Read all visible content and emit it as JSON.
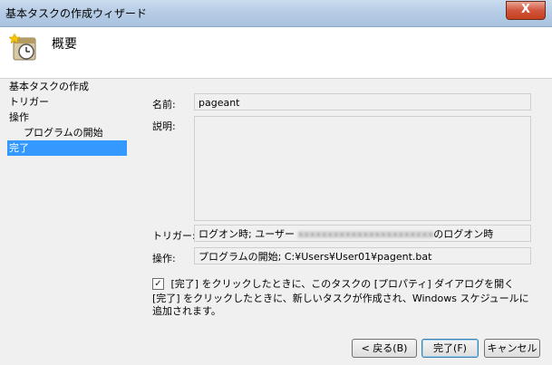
{
  "window": {
    "title": "基本タスクの作成ウィザード",
    "close_symbol": "X"
  },
  "header": {
    "title": "概要",
    "icon": "task-scheduler-clock-icon"
  },
  "nav": {
    "items": [
      {
        "label": "基本タスクの作成",
        "selected": false
      },
      {
        "label": "トリガー",
        "selected": false
      },
      {
        "label": "操作",
        "selected": false
      },
      {
        "label": "プログラムの開始",
        "selected": false,
        "sub": true
      },
      {
        "label": "完了",
        "selected": true
      }
    ]
  },
  "form": {
    "name_label": "名前:",
    "name_value": "pageant",
    "description_label": "説明:",
    "description_value": "",
    "trigger_label": "トリガー:",
    "trigger_prefix": "ログオン時; ユーザー",
    "trigger_user": "xxxxxxxxxxxxxxxxxxxxxxx",
    "trigger_suffix": "のログオン時",
    "action_label": "操作:",
    "action_value": "プログラムの開始; C:¥Users¥User01¥pagent.bat"
  },
  "option": {
    "checked": true,
    "checkmark": "✓",
    "label": "[完了] をクリックしたときに、このタスクの [プロパティ] ダイアログを開く"
  },
  "info_text": "[完了] をクリックしたときに、新しいタスクが作成され、Windows スケジュールに追加されます。",
  "buttons": {
    "back": "< 戻る(B)",
    "finish": "完了(F)",
    "cancel": "キャンセル"
  }
}
